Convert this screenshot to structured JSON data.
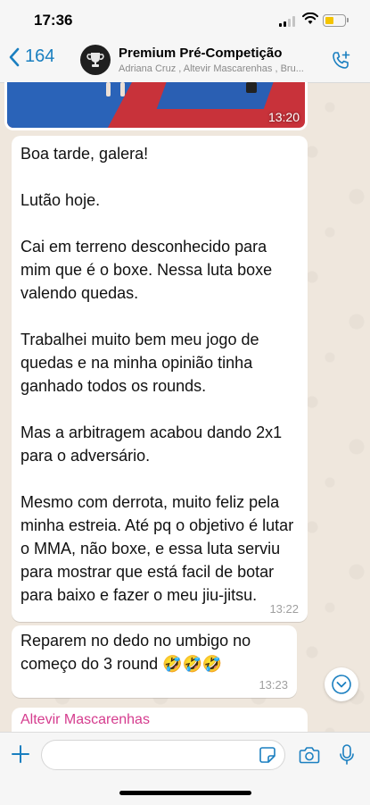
{
  "status": {
    "time": "17:36"
  },
  "header": {
    "back_count": "164",
    "title": "Premium Pré-Competição",
    "members": "Adriana Cruz , Altevir Mascarenhas , Bru..."
  },
  "image_message": {
    "time": "13:20"
  },
  "messages": [
    {
      "text": "Boa tarde, galera!\n\nLutão hoje.\n\nCai em terreno desconhecido para mim que é o boxe. Nessa luta boxe valendo quedas.\n\nTrabalhei muito bem meu jogo de quedas e na minha opinião tinha ganhado todos os rounds.\n\nMas a arbitragem acabou dando 2x1 para o adversário.\n\nMesmo com derrota, muito feliz pela minha estreia. Até pq o objetivo é lutar o MMA, não boxe, e essa luta serviu para mostrar que está facil de botar para baixo e fazer o meu jiu-jitsu.",
      "time": "13:22"
    },
    {
      "text": "Reparem no dedo no umbigo no começo do 3 round 🤣🤣🤣",
      "time": "13:23"
    }
  ],
  "next_message": {
    "sender": "Altevir Mascarenhas"
  },
  "input": {
    "placeholder": ""
  },
  "colors": {
    "accent": "#1a7fc0",
    "sender": "#d53c8e",
    "chat_bg": "#efe7dd"
  }
}
